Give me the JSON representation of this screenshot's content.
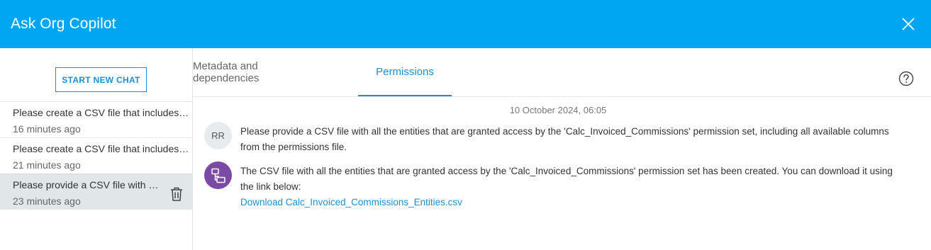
{
  "header": {
    "title": "Ask Org Copilot"
  },
  "sidebar": {
    "new_chat_label": "START NEW CHAT",
    "history": [
      {
        "title": "Please create a CSV file that includes all the entities",
        "time": "16 minutes ago"
      },
      {
        "title": "Please create a CSV file that includes all the entities",
        "time": "21 minutes ago"
      },
      {
        "title": "Please provide a CSV file with all the entities",
        "time": "23 minutes ago"
      }
    ]
  },
  "tabs": [
    {
      "label": "Metadata and dependencies"
    },
    {
      "label": "Permissions"
    }
  ],
  "chat": {
    "date": "10 October 2024, 06:05",
    "user_initials": "RR",
    "user_message": "Please provide a CSV file with all the entities that are granted access by the 'Calc_Invoiced_Commissions' permission set, including all available columns from the permissions file.",
    "bot_message": "The CSV file with all the entities that are granted access by the 'Calc_Invoiced_Commissions' permission set has been created. You can download it using the link below:",
    "bot_link": "Download Calc_Invoiced_Commissions_Entities.csv"
  },
  "colors": {
    "header": "#00a6f2",
    "accent": "#1a8fd6",
    "bot_avatar": "#7a4aa6"
  }
}
